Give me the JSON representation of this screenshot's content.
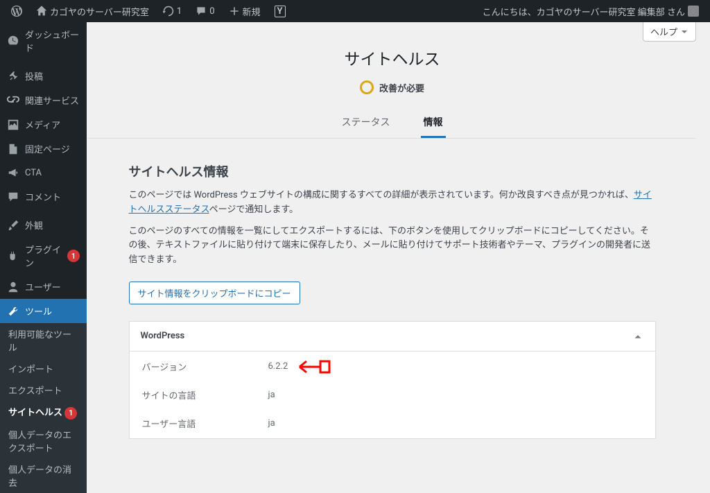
{
  "adminbar": {
    "site_name": "カゴヤのサーバー研究室",
    "updates_count": "1",
    "comments_count": "0",
    "new_label": "新規",
    "yoast_label": "Y",
    "greeting": "こんにちは、カゴヤのサーバー研究室 編集部 さん"
  },
  "sidebar": {
    "items": [
      {
        "label": "ダッシュボード"
      },
      {
        "label": "投稿"
      },
      {
        "label": "関連サービス"
      },
      {
        "label": "メディア"
      },
      {
        "label": "固定ページ"
      },
      {
        "label": "CTA"
      },
      {
        "label": "コメント"
      },
      {
        "label": "外観"
      },
      {
        "label": "プラグイン",
        "badge": "1"
      },
      {
        "label": "ユーザー"
      },
      {
        "label": "ツール"
      }
    ],
    "submenu": [
      {
        "label": "利用可能なツール"
      },
      {
        "label": "インポート"
      },
      {
        "label": "エクスポート"
      },
      {
        "label": "サイトヘルス",
        "badge": "1"
      },
      {
        "label": "個人データのエクスポート"
      },
      {
        "label": "個人データの消去"
      }
    ]
  },
  "help_label": "ヘルプ",
  "page": {
    "title": "サイトヘルス",
    "status_label": "改善が必要",
    "tab_status": "ステータス",
    "tab_info": "情報"
  },
  "info": {
    "heading": "サイトヘルス情報",
    "para1_a": "このページでは WordPress ウェブサイトの構成に関するすべての詳細が表示されています。何か改良すべき点が見つかれば、",
    "para1_link": "サイトヘルスステータス",
    "para1_b": "ページで通知します。",
    "para2": "このページのすべての情報を一覧にしてエクスポートするには、下のボタンを使用してクリップボードにコピーしてください。その後、テキストファイルに貼り付けて端末に保存したり、メールに貼り付けてサポート技術者やテーマ、プラグインの開発者に送信できます。",
    "copy_button": "サイト情報をクリップボードにコピー"
  },
  "accordion": {
    "title": "WordPress",
    "rows": [
      {
        "label": "バージョン",
        "value": "6.2.2"
      },
      {
        "label": "サイトの言語",
        "value": "ja"
      },
      {
        "label": "ユーザー言語",
        "value": "ja"
      }
    ]
  }
}
